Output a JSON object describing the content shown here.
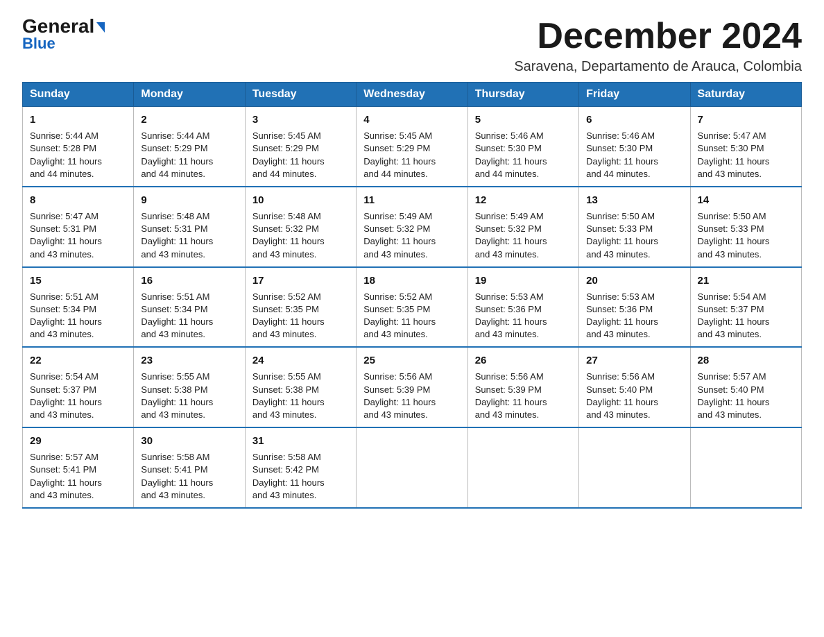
{
  "logo": {
    "general": "General",
    "blue": "Blue",
    "arrow": "▶"
  },
  "header": {
    "month_title": "December 2024",
    "location": "Saravena, Departamento de Arauca, Colombia"
  },
  "weekdays": [
    "Sunday",
    "Monday",
    "Tuesday",
    "Wednesday",
    "Thursday",
    "Friday",
    "Saturday"
  ],
  "weeks": [
    [
      {
        "day": "1",
        "sunrise": "5:44 AM",
        "sunset": "5:28 PM",
        "daylight": "11 hours and 44 minutes."
      },
      {
        "day": "2",
        "sunrise": "5:44 AM",
        "sunset": "5:29 PM",
        "daylight": "11 hours and 44 minutes."
      },
      {
        "day": "3",
        "sunrise": "5:45 AM",
        "sunset": "5:29 PM",
        "daylight": "11 hours and 44 minutes."
      },
      {
        "day": "4",
        "sunrise": "5:45 AM",
        "sunset": "5:29 PM",
        "daylight": "11 hours and 44 minutes."
      },
      {
        "day": "5",
        "sunrise": "5:46 AM",
        "sunset": "5:30 PM",
        "daylight": "11 hours and 44 minutes."
      },
      {
        "day": "6",
        "sunrise": "5:46 AM",
        "sunset": "5:30 PM",
        "daylight": "11 hours and 44 minutes."
      },
      {
        "day": "7",
        "sunrise": "5:47 AM",
        "sunset": "5:30 PM",
        "daylight": "11 hours and 43 minutes."
      }
    ],
    [
      {
        "day": "8",
        "sunrise": "5:47 AM",
        "sunset": "5:31 PM",
        "daylight": "11 hours and 43 minutes."
      },
      {
        "day": "9",
        "sunrise": "5:48 AM",
        "sunset": "5:31 PM",
        "daylight": "11 hours and 43 minutes."
      },
      {
        "day": "10",
        "sunrise": "5:48 AM",
        "sunset": "5:32 PM",
        "daylight": "11 hours and 43 minutes."
      },
      {
        "day": "11",
        "sunrise": "5:49 AM",
        "sunset": "5:32 PM",
        "daylight": "11 hours and 43 minutes."
      },
      {
        "day": "12",
        "sunrise": "5:49 AM",
        "sunset": "5:32 PM",
        "daylight": "11 hours and 43 minutes."
      },
      {
        "day": "13",
        "sunrise": "5:50 AM",
        "sunset": "5:33 PM",
        "daylight": "11 hours and 43 minutes."
      },
      {
        "day": "14",
        "sunrise": "5:50 AM",
        "sunset": "5:33 PM",
        "daylight": "11 hours and 43 minutes."
      }
    ],
    [
      {
        "day": "15",
        "sunrise": "5:51 AM",
        "sunset": "5:34 PM",
        "daylight": "11 hours and 43 minutes."
      },
      {
        "day": "16",
        "sunrise": "5:51 AM",
        "sunset": "5:34 PM",
        "daylight": "11 hours and 43 minutes."
      },
      {
        "day": "17",
        "sunrise": "5:52 AM",
        "sunset": "5:35 PM",
        "daylight": "11 hours and 43 minutes."
      },
      {
        "day": "18",
        "sunrise": "5:52 AM",
        "sunset": "5:35 PM",
        "daylight": "11 hours and 43 minutes."
      },
      {
        "day": "19",
        "sunrise": "5:53 AM",
        "sunset": "5:36 PM",
        "daylight": "11 hours and 43 minutes."
      },
      {
        "day": "20",
        "sunrise": "5:53 AM",
        "sunset": "5:36 PM",
        "daylight": "11 hours and 43 minutes."
      },
      {
        "day": "21",
        "sunrise": "5:54 AM",
        "sunset": "5:37 PM",
        "daylight": "11 hours and 43 minutes."
      }
    ],
    [
      {
        "day": "22",
        "sunrise": "5:54 AM",
        "sunset": "5:37 PM",
        "daylight": "11 hours and 43 minutes."
      },
      {
        "day": "23",
        "sunrise": "5:55 AM",
        "sunset": "5:38 PM",
        "daylight": "11 hours and 43 minutes."
      },
      {
        "day": "24",
        "sunrise": "5:55 AM",
        "sunset": "5:38 PM",
        "daylight": "11 hours and 43 minutes."
      },
      {
        "day": "25",
        "sunrise": "5:56 AM",
        "sunset": "5:39 PM",
        "daylight": "11 hours and 43 minutes."
      },
      {
        "day": "26",
        "sunrise": "5:56 AM",
        "sunset": "5:39 PM",
        "daylight": "11 hours and 43 minutes."
      },
      {
        "day": "27",
        "sunrise": "5:56 AM",
        "sunset": "5:40 PM",
        "daylight": "11 hours and 43 minutes."
      },
      {
        "day": "28",
        "sunrise": "5:57 AM",
        "sunset": "5:40 PM",
        "daylight": "11 hours and 43 minutes."
      }
    ],
    [
      {
        "day": "29",
        "sunrise": "5:57 AM",
        "sunset": "5:41 PM",
        "daylight": "11 hours and 43 minutes."
      },
      {
        "day": "30",
        "sunrise": "5:58 AM",
        "sunset": "5:41 PM",
        "daylight": "11 hours and 43 minutes."
      },
      {
        "day": "31",
        "sunrise": "5:58 AM",
        "sunset": "5:42 PM",
        "daylight": "11 hours and 43 minutes."
      },
      null,
      null,
      null,
      null
    ]
  ],
  "labels": {
    "sunrise": "Sunrise:",
    "sunset": "Sunset:",
    "daylight": "Daylight:"
  }
}
